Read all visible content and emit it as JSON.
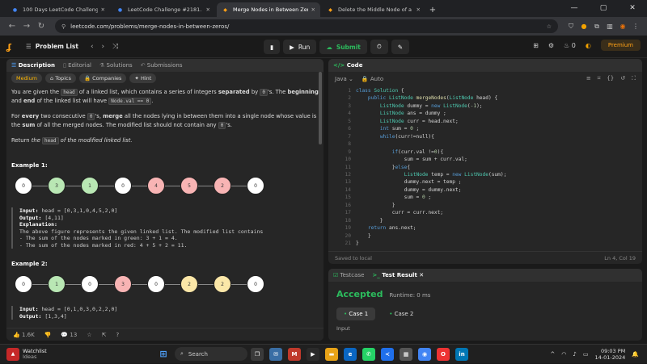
{
  "browser": {
    "tabs": [
      {
        "title": "100 Days LeetCode Challenge",
        "fav_color": "#4285f4",
        "fav": "●"
      },
      {
        "title": "LeetCode Challenge #2181. Me",
        "fav_color": "#4285f4",
        "fav": "●"
      },
      {
        "title": "Merge Nodes in Between Zeros",
        "fav_color": "#ffa116",
        "fav": "◆",
        "active": true
      },
      {
        "title": "Delete the Middle Node of a Li",
        "fav_color": "#ffa116",
        "fav": "◆"
      }
    ],
    "url": "leetcode.com/problems/merge-nodes-in-between-zeros/",
    "back_icon": "←",
    "forward_icon": "→",
    "reload_icon": "↻"
  },
  "nav": {
    "problem_list": "Problem List",
    "run": "Run",
    "submit": "Submit",
    "streak": "0",
    "premium": "Premium"
  },
  "left_tabs": [
    "Description",
    "Editorial",
    "Solutions",
    "Submissions"
  ],
  "tags": {
    "difficulty": "Medium",
    "topics": "Topics",
    "companies": "Companies",
    "hint": "Hint"
  },
  "description": {
    "p1_a": "You are given the ",
    "p1_code1": "head",
    "p1_b": " of a linked list, which contains a series of integers ",
    "p1_bold1": "separated",
    "p1_c": " by ",
    "p1_code2": "0",
    "p1_d": "'s. The ",
    "p1_bold2": "beginning",
    "p1_e": " and ",
    "p1_bold3": "end",
    "p1_f": " of the linked list will have ",
    "p1_code3": "Node.val == 0",
    "p1_g": ".",
    "p2_a": "For ",
    "p2_bold1": "every",
    "p2_b": " two consecutive ",
    "p2_code1": "0",
    "p2_c": "'s, ",
    "p2_bold2": "merge",
    "p2_d": " all the nodes lying in between them into a single node whose value is the ",
    "p2_bold3": "sum",
    "p2_e": " of all the merged nodes. The modified list should not contain any ",
    "p2_code2": "0",
    "p2_f": "'s.",
    "p3_a": "Return ",
    "p3_i1": "the ",
    "p3_code1": "head",
    "p3_i2": " of the modified linked list."
  },
  "example1": {
    "title": "Example 1:",
    "nodes": [
      {
        "v": "0",
        "c": "#ffffff"
      },
      {
        "v": "3",
        "c": "#b9e7b4"
      },
      {
        "v": "1",
        "c": "#b9e7b4"
      },
      {
        "v": "0",
        "c": "#ffffff"
      },
      {
        "v": "4",
        "c": "#f8b4b4"
      },
      {
        "v": "5",
        "c": "#f8b4b4"
      },
      {
        "v": "2",
        "c": "#f8b4b4"
      },
      {
        "v": "0",
        "c": "#ffffff"
      }
    ],
    "input_label": "Input:",
    "input": " head = [0,3,1,0,4,5,2,0]",
    "output_label": "Output:",
    "output": " [4,11]",
    "explanation_label": "Explanation:",
    "explanation_lines": [
      "The above figure represents the given linked list. The modified list contains",
      "- The sum of the nodes marked in green: 3 + 1 = 4.",
      "- The sum of the nodes marked in red: 4 + 5 + 2 = 11."
    ]
  },
  "example2": {
    "title": "Example 2:",
    "nodes": [
      {
        "v": "0",
        "c": "#ffffff"
      },
      {
        "v": "1",
        "c": "#b9e7b4"
      },
      {
        "v": "0",
        "c": "#ffffff"
      },
      {
        "v": "3",
        "c": "#f8b4b4"
      },
      {
        "v": "0",
        "c": "#ffffff"
      },
      {
        "v": "2",
        "c": "#fbe7a8"
      },
      {
        "v": "2",
        "c": "#fbe7a8"
      },
      {
        "v": "0",
        "c": "#ffffff"
      }
    ],
    "input_label": "Input:",
    "input": " head = [0,1,0,3,0,2,2,0]",
    "output_label": "Output:",
    "output": " [1,3,4]"
  },
  "desc_footer": {
    "likes": "1.6K",
    "comments": "13"
  },
  "code_panel": {
    "title": "Code",
    "language": "Java",
    "mode": "Auto",
    "saved": "Saved to local",
    "cursor": "Ln 4, Col 19",
    "lines": [
      "class Solution {",
      "    public ListNode mergeNodes(ListNode head) {",
      "        ListNode dummy = new ListNode(-1);",
      "        ListNode ans = dummy ;",
      "        ListNode curr = head.next;",
      "        int sum = 0 ;",
      "        while(curr!=null){",
      "",
      "            if(curr.val !=0){",
      "                sum = sum + curr.val;",
      "            }else{",
      "                ListNode temp = new ListNode(sum);",
      "                dummy.next = temp ;",
      "                dummy = dummy.next;",
      "                sum = 0 ;",
      "            }",
      "            curr = curr.next;",
      "        }",
      "    return ans.next;",
      "    }",
      "}"
    ]
  },
  "result_panel": {
    "testcase": "Testcase",
    "test_result": "Test Result",
    "status": "Accepted",
    "runtime": "Runtime: 0 ms",
    "case1": "Case 1",
    "case2": "Case 2",
    "input_label": "Input"
  },
  "taskbar": {
    "weather_title": "Watchlist",
    "weather_sub": "Ideas",
    "search": "Search",
    "time": "09:03 PM",
    "date": "14-01-2024"
  }
}
